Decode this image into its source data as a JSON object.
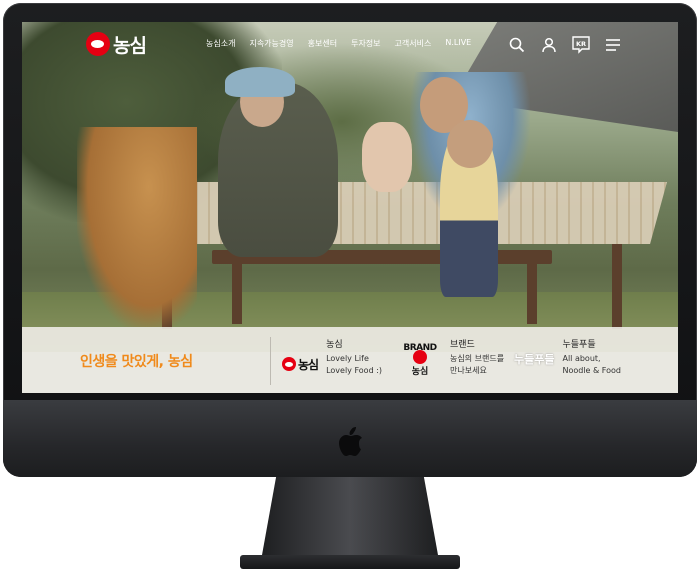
{
  "brand": {
    "logo_text": "농심",
    "accent": "#e60012"
  },
  "nav": {
    "items": [
      "농심소개",
      "지속가능경영",
      "홍보센터",
      "투자정보",
      "고객서비스",
      "N.LIVE"
    ]
  },
  "header_icons": {
    "search": "search-icon",
    "account": "user-icon",
    "language": "KR",
    "menu": "menu-icon"
  },
  "band": {
    "slogan": "인생을 맛있게, 농심",
    "slogan_color": "#f08a1b",
    "nongshim": {
      "logo": "농심",
      "title": "농심",
      "line1": "Lovely Life",
      "line2": "Lovely Food :)"
    },
    "brand": {
      "logo_top": "BRAND",
      "logo_bottom": "농심",
      "title": "브랜드",
      "line1": "농심의 브랜드를",
      "line2": "만나보세요"
    },
    "noodle": {
      "logo": "누들푸들",
      "title": "누들푸들",
      "line1": "All about,",
      "line2": "Noodle & Food"
    }
  }
}
